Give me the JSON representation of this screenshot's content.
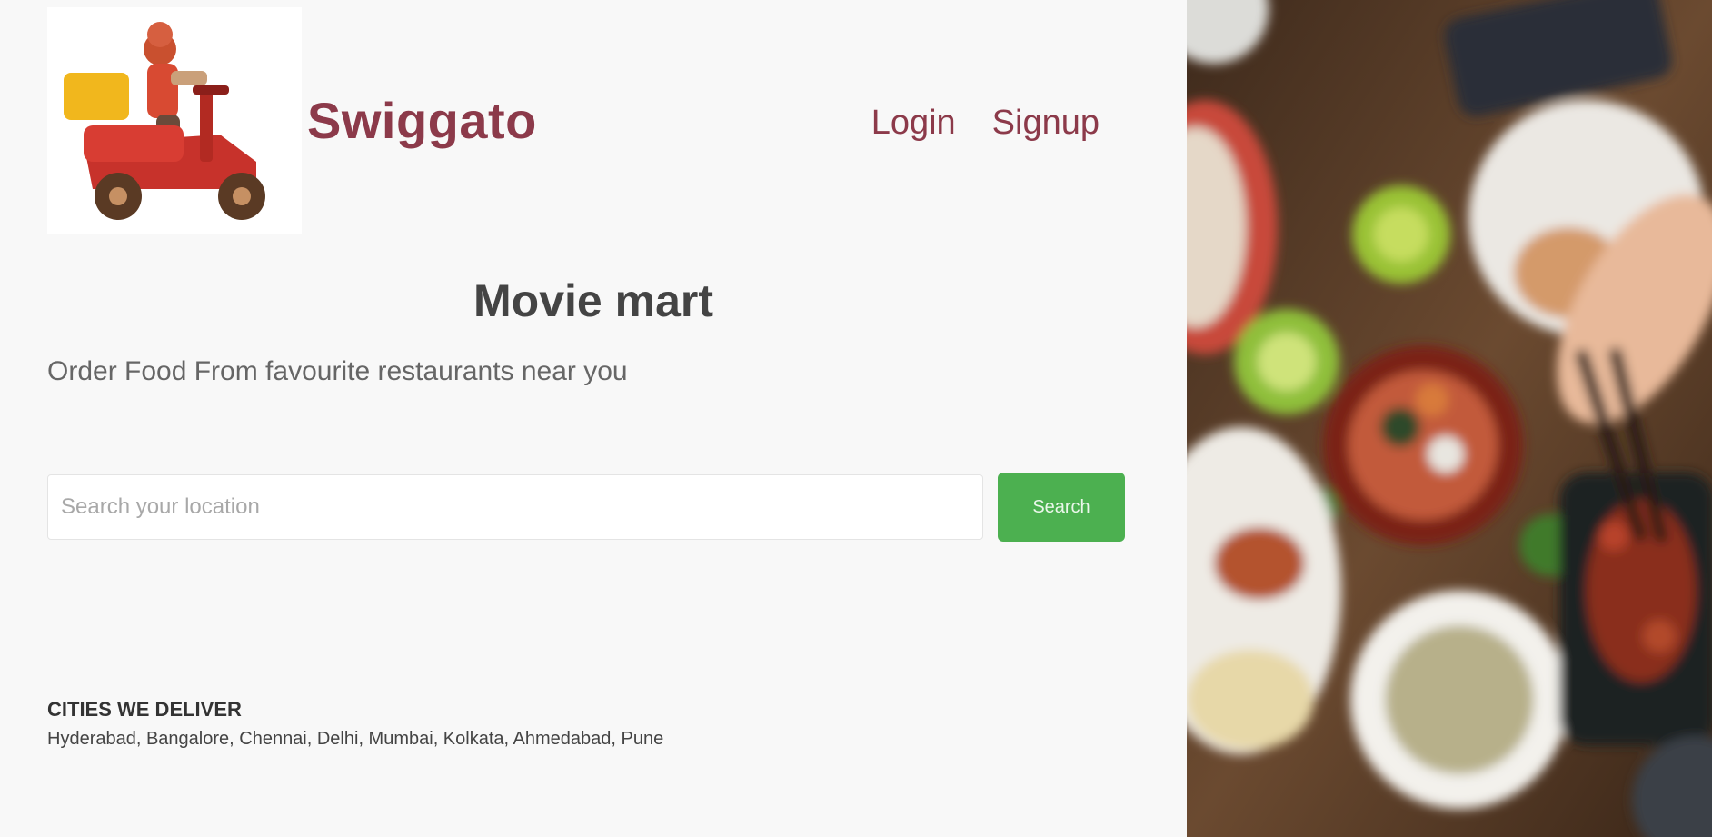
{
  "header": {
    "brand": "Swiggato",
    "nav": {
      "login_label": "Login",
      "signup_label": "Signup"
    }
  },
  "hero": {
    "title": "Movie mart",
    "subtitle": "Order Food From favourite restaurants near you"
  },
  "search": {
    "placeholder": "Search your location",
    "button_label": "Search"
  },
  "footer": {
    "title": "CITIES WE DELIVER",
    "text": "Hyderabad, Bangalore, Chennai, Delhi, Mumbai, Kolkata, Ahmedabad, Pune"
  },
  "colors": {
    "brand": "#8c3a4a",
    "accent_button": "#4cb050",
    "page_background": "#f8f8f8"
  },
  "icons": {
    "logo": "delivery-scooter-logo",
    "side_image": "food-table-image"
  }
}
